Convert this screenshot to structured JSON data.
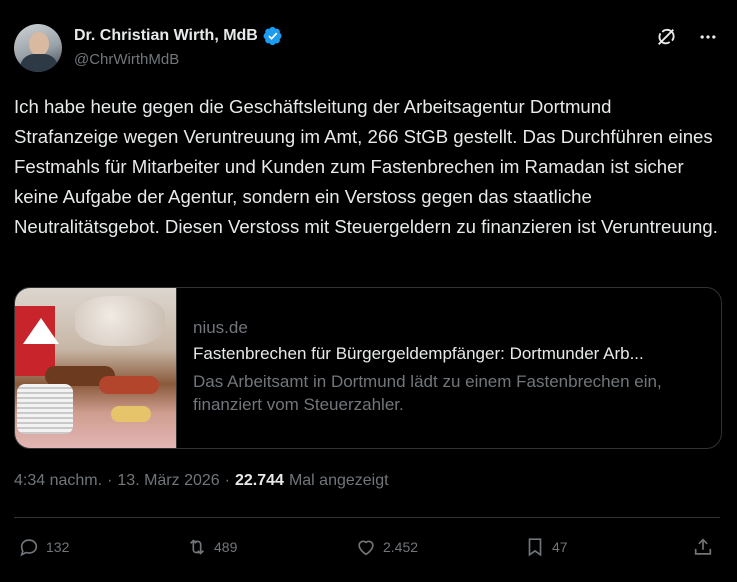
{
  "author": {
    "name": "Dr. Christian Wirth, MdB",
    "handle": "@ChrWirthMdB",
    "verified": true
  },
  "tweet": {
    "text": "Ich habe heute gegen die Geschäftsleitung der Arbeitsagentur Dortmund Strafanzeige wegen Veruntreuung im Amt, 266 StGB gestellt. Das Durchführen eines Festmahls für Mitarbeiter und Kunden zum Fastenbrechen im Ramadan ist sicher keine Aufgabe der Agentur, sondern ein Verstoss gegen das staatliche Neutralitätsgebot. Diesen Verstoss mit Steuergeldern zu finanzieren ist Veruntreuung."
  },
  "card": {
    "domain": "nius.de",
    "title": "Fastenbrechen für Bürgergeldempfänger: Dortmunder Arb...",
    "description": "Das Arbeitsamt in Dortmund lädt zu einem Fastenbrechen ein, finanziert vom Steuerzahler."
  },
  "meta": {
    "time": "4:34 nachm.",
    "separator1": "·",
    "date": "13. März 2026",
    "separator2": "·",
    "views": "22.744",
    "views_label": "Mal angezeigt"
  },
  "actions": {
    "replies": "132",
    "reposts": "489",
    "likes": "2.452",
    "bookmarks": "47"
  },
  "colors": {
    "background": "#000000",
    "text": "#e7e9ea",
    "secondary": "#71767b",
    "border": "#2f3336",
    "verified": "#1d9bf0"
  }
}
